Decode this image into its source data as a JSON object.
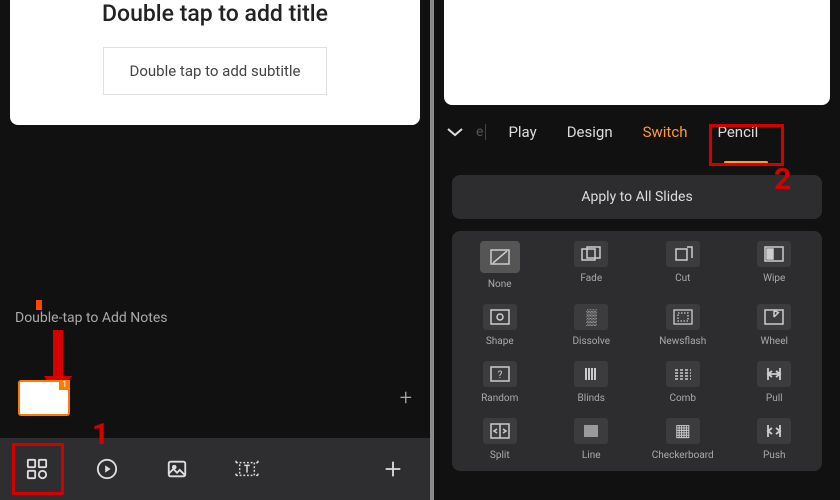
{
  "left": {
    "slide_title": "Double tap to add title",
    "slide_subtitle": "Double tap to add subtitle",
    "notes_placeholder": "Double-tap to Add Notes",
    "annotation_1": "1"
  },
  "right": {
    "tabs": {
      "play": "Play",
      "design": "Design",
      "switch": "Switch",
      "pencil": "Pencil"
    },
    "apply_all": "Apply to All Slides",
    "annotation_2": "2",
    "transitions": [
      {
        "label": "None"
      },
      {
        "label": "Fade"
      },
      {
        "label": "Cut"
      },
      {
        "label": "Wipe"
      },
      {
        "label": "Shape"
      },
      {
        "label": "Dissolve"
      },
      {
        "label": "Newsflash"
      },
      {
        "label": "Wheel"
      },
      {
        "label": "Random"
      },
      {
        "label": "Blinds"
      },
      {
        "label": "Comb"
      },
      {
        "label": "Pull"
      },
      {
        "label": "Split"
      },
      {
        "label": "Line"
      },
      {
        "label": "Checkerboard"
      },
      {
        "label": "Push"
      }
    ]
  }
}
